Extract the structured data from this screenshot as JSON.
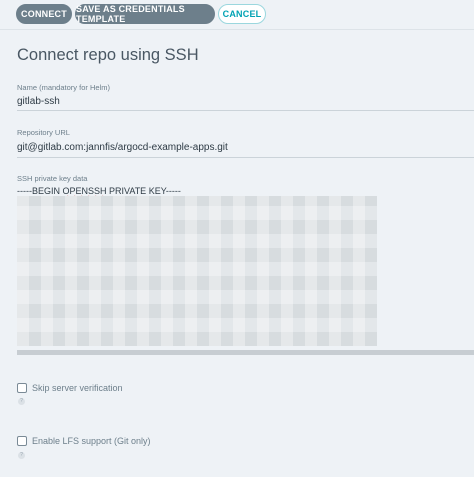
{
  "toolbar": {
    "connect_label": "CONNECT",
    "save_template_label": "SAVE AS CREDENTIALS TEMPLATE",
    "cancel_label": "CANCEL"
  },
  "form": {
    "title": "Connect repo using SSH",
    "name": {
      "label": "Name (mandatory for Helm)",
      "value": "gitlab-ssh"
    },
    "repo_url": {
      "label": "Repository URL",
      "value": "git@gitlab.com:jannfis/argocd-example-apps.git"
    },
    "ssh_key": {
      "label": "SSH private key data",
      "value_prefix": "-----BEGIN ",
      "value_spell": "OPENSSH",
      "value_suffix": " PRIVATE KEY-----"
    },
    "skip_server_verification": {
      "label": "Skip server verification",
      "checked": false
    },
    "enable_lfs": {
      "label": "Enable LFS support (Git only)",
      "checked": false
    }
  },
  "icons": {
    "help": "question-circle-icon"
  },
  "colors": {
    "accent": "#00a2b3",
    "button_dark": "#6d7f8b",
    "background": "#eef2f6"
  }
}
